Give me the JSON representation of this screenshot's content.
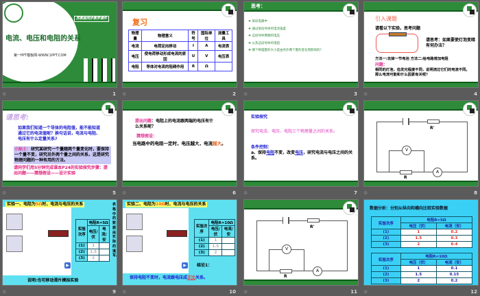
{
  "slides": [
    {
      "number": "1",
      "title": "电流、电压和电阻的关系",
      "badge": "苏教版同步教学课件",
      "site": "第一PPT模板网-WWW.1PPT.COM"
    },
    {
      "number": "2",
      "heading": "复习",
      "headers": [
        "物理量",
        "物理意义",
        "符号",
        "国际单位",
        "测量工具"
      ],
      "rows": [
        [
          "电流",
          "电荷定向移动",
          "I",
          "A",
          "电流表"
        ],
        [
          "电压",
          "使电荷移动形成电流的原因",
          "U",
          "V",
          "电压表"
        ],
        [
          "电阻",
          "导体对电流的阻碍作用",
          "R",
          "Ω",
          ""
        ]
      ]
    },
    {
      "number": "3",
      "heading": "思考：",
      "bullets": [
        "某段电路中",
        "通过某段导体的电流强度",
        "这段导体两端的电压",
        "以及这段导体的电阻",
        "哪个物理量的大小是由另外两个量的变化而影响的？"
      ]
    },
    {
      "number": "4",
      "heading": "引入课题",
      "intro": "请看以下实验，思考问题",
      "think": "请思考：如果要使灯泡变暗有何办法？",
      "methods": "方法一:去掉一节电池 方法二:给电路增加电阻",
      "q_label": "问题：",
      "question": "相同的灯泡，但发光程度不同，说明流过它们的电流不同。那么电流可能和什么因素有关呢？"
    },
    {
      "number": "5",
      "heading": "请思考:",
      "p1": "如果我们知道一个导体的电阻值，能不能知道通过它的电流值呢？换句话说，电流与电阻、电压有什么定量关系?",
      "tip_label": "小贴士：",
      "tip": "研究某研究一个量随两个量变化时，要保持一个量不变，研究另外两个量之间的关系，这是研究物理问题的一种有用的方法。",
      "task": "请同学们用5分钟完成课本P24的实验探究步骤：提出问题——猜想假设——设计实验"
    },
    {
      "number": "6",
      "q_label": "提出问题",
      "question": "：电阻上的电流跟两端的电压有什么关系呢？",
      "h_label": "猜想假设：",
      "hyp": "当电路中的电阻一定时，电压越大，电流",
      "hyp_ans": "越大"
    },
    {
      "number": "7",
      "heading": "实验探究",
      "goal": "探究电流、电压、电阻三个物理量之间的关系。",
      "cond_label": "条件控制：",
      "cond_a": "a、保持",
      "blank1": "电阻",
      "cond_b": "不变，改变",
      "blank2": "电压",
      "cond_c": "，研究电流与电压之间的关系。"
    },
    {
      "number": "8",
      "labels": [
        "R'",
        "V",
        "A",
        "R"
      ]
    },
    {
      "number": "9",
      "heading_a": "实验一、电阻为",
      "heading_r": "5Ω",
      "heading_b": "时，电流与电压的关系",
      "side": "表格中的数据由实际的填写。",
      "t_order": "实验次序",
      "t_res": "电阻R=5Ω",
      "t_v": "电压/伏",
      "t_i": "电流/安",
      "rows": [
        [
          "(1)",
          "1",
          ""
        ],
        [
          "(2)",
          "1.5",
          ""
        ],
        [
          "(3)",
          "2",
          ""
        ]
      ],
      "note": "说明:也可移动滑片模拟实验"
    },
    {
      "number": "10",
      "heading_a": "实验二、电阻为",
      "heading_r": "10Ω",
      "heading_b": "时，电流与电压的关系",
      "t_order": "实验次序",
      "t_res": "电阻R=10Ω",
      "t_v": "电压/伏",
      "t_i": "电流/安",
      "rows": [
        [
          "(1)",
          "1",
          ""
        ],
        [
          "(2)",
          "1.5",
          ""
        ],
        [
          "(3)",
          "2",
          ""
        ]
      ],
      "concl_label": "结论1：",
      "concl_a": "保持电阻不变时，电流跟电压成",
      "concl_ans": "正比",
      "concl_b": "关系。"
    },
    {
      "number": "11",
      "labels": [
        "R'",
        "V",
        "A",
        "R"
      ]
    },
    {
      "number": "12",
      "heading": "数据分析：分别从纵向和横向比较实验数据",
      "tables": [
        {
          "order": "实验次序",
          "res": "电阻R=5Ω",
          "v": "电压（伏）",
          "i": "电流（安）",
          "rows": [
            [
              "(1)",
              "1",
              "0.2"
            ],
            [
              "(2)",
              "1.5",
              "0.3"
            ],
            [
              "(3)",
              "2",
              "0.4"
            ]
          ]
        },
        {
          "order": "实验次序",
          "res": "电阻R=10Ω",
          "v": "电压（伏）",
          "i": "电流（安）",
          "rows": [
            [
              "(1)",
              "1",
              "0.1"
            ],
            [
              "(2)",
              "1.5",
              "0.15"
            ],
            [
              "(3)",
              "2",
              "0.2"
            ]
          ]
        }
      ]
    }
  ],
  "star_icon": "☆"
}
